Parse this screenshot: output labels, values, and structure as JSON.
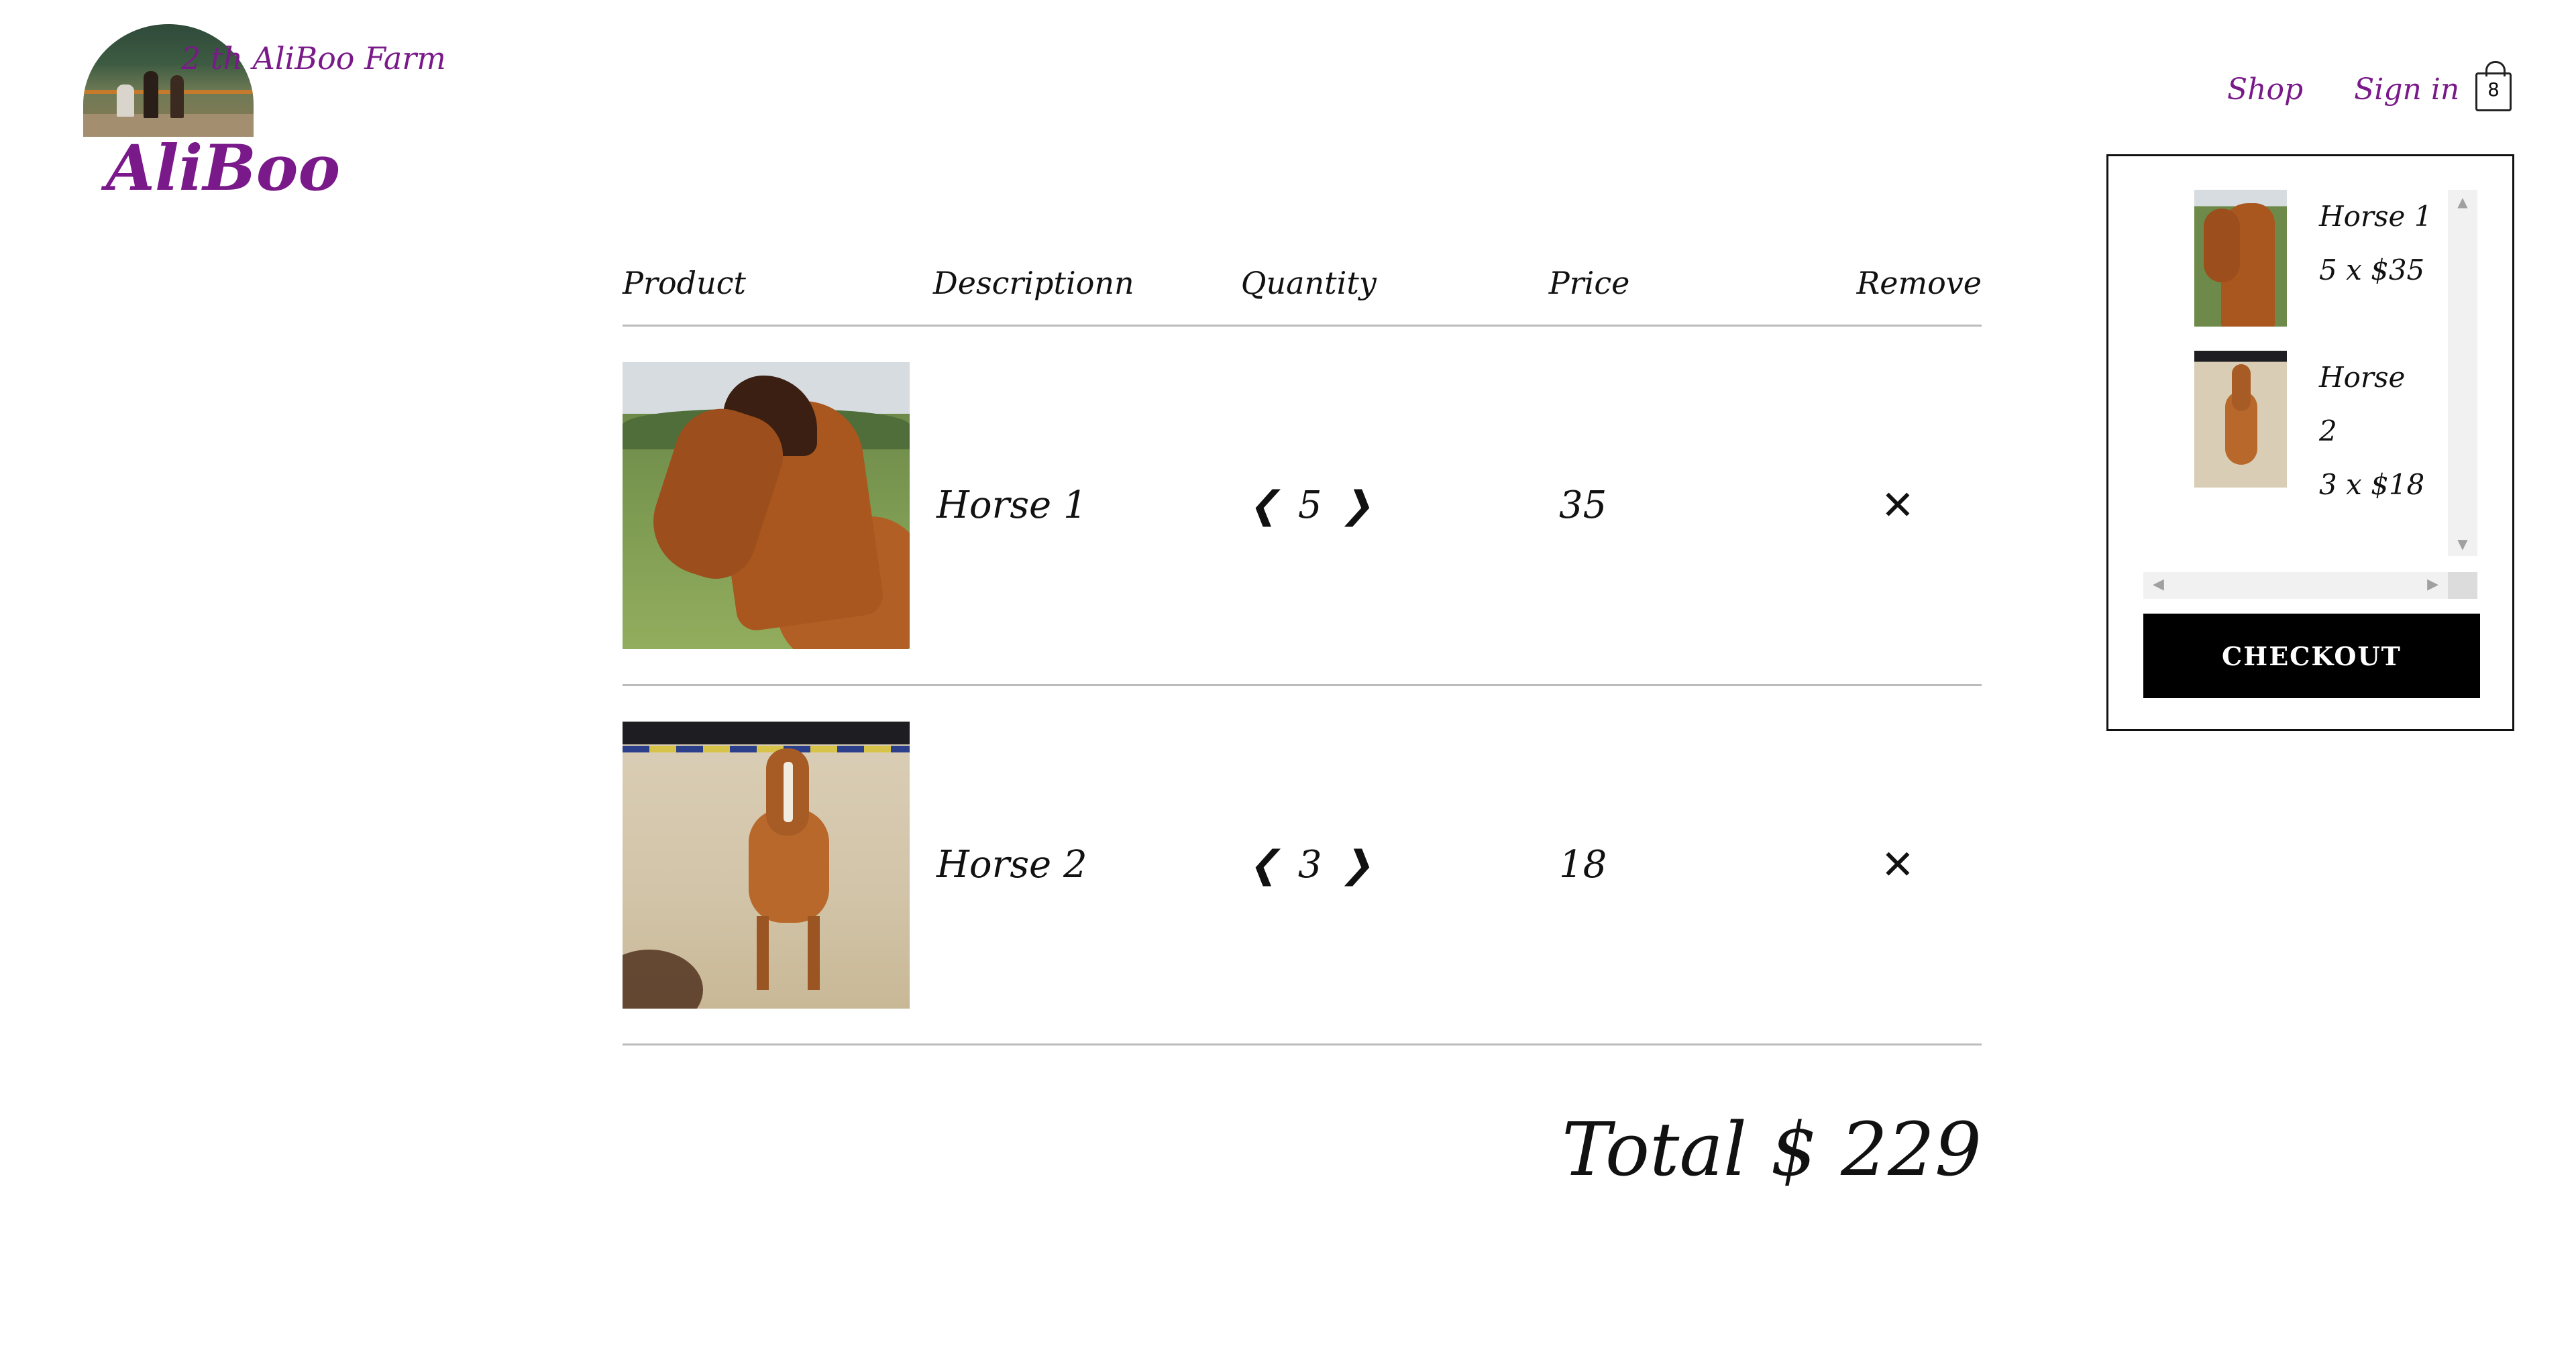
{
  "brand": {
    "tagline": "2 th AliBoo Farm",
    "name": "AliBoo"
  },
  "nav": {
    "shop": "Shop",
    "sign_in": "Sign in",
    "cart_count": "8"
  },
  "table": {
    "headers": [
      "Product",
      "Descriptionn",
      "Quantity",
      "Price",
      "Remove"
    ],
    "rows": [
      {
        "name": "Horse 1",
        "qty_left": "❮",
        "qty": "5",
        "qty_right": "❯",
        "price": "35",
        "remove": "✕"
      },
      {
        "name": "Horse 2",
        "qty_left": "❮",
        "qty": "3",
        "qty_right": "❯",
        "price": "18",
        "remove": "✕"
      }
    ]
  },
  "total": "Total $ 229",
  "mini_cart": {
    "items": [
      {
        "name": "Horse 1",
        "line2": "5 x $35",
        "line3": ""
      },
      {
        "name": "Horse",
        "line2": "2",
        "line3": "3 x $18"
      }
    ],
    "checkout": "CHECKOUT",
    "scroll_up": "▲",
    "scroll_down": "▼",
    "scroll_left": "◀",
    "scroll_right": "▶"
  }
}
